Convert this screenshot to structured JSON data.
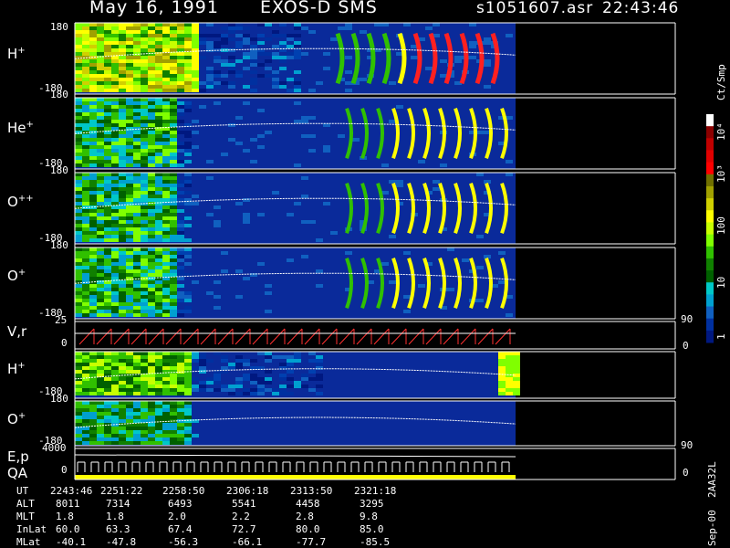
{
  "header": {
    "date": "May 16, 1991",
    "instrument": "EXOS-D SMS",
    "file": "s1051607.asr",
    "time": "22:43:46"
  },
  "panels": [
    {
      "label": "H",
      "sup": "+",
      "ymax": "180",
      "ymin": "-180"
    },
    {
      "label": "He",
      "sup": "+",
      "ymax": "180",
      "ymin": "-180"
    },
    {
      "label": "O",
      "sup": "++",
      "ymax": "180",
      "ymin": "-180"
    },
    {
      "label": "O",
      "sup": "+",
      "ymax": "180",
      "ymin": "-180"
    }
  ],
  "vr_panel": {
    "label": "V,r",
    "ymax": "25",
    "ymin": "0",
    "right_max": "90",
    "right_min": "0"
  },
  "energy_panels": [
    {
      "label": "H",
      "sup": "+",
      "ymax": "180",
      "ymin": "-180"
    },
    {
      "label": "O",
      "sup": "+",
      "ymax": "180",
      "ymin": "-180"
    }
  ],
  "ep_panel": {
    "label1": "E,p",
    "label2": "QA",
    "ymax": "4000",
    "ymin": "0",
    "right_max": "90",
    "right_min": "0"
  },
  "colorbar": {
    "unit": "Ct/Smp",
    "ticks": [
      "10⁴",
      "10³",
      "100",
      "10",
      "1"
    ],
    "colors": [
      "#ffffff",
      "#8b0000",
      "#c00000",
      "#e00000",
      "#ff0000",
      "#707000",
      "#a0a000",
      "#d0d000",
      "#ffff00",
      "#c8ff00",
      "#80ff00",
      "#30c000",
      "#108000",
      "#006000",
      "#00c8c8",
      "#00a0d0",
      "#1060c0",
      "#0030a0",
      "#001880"
    ]
  },
  "footer": {
    "rows": [
      {
        "name": "UT",
        "values": [
          "2243:46",
          "2251:22",
          "2258:50",
          "2306:18",
          "2313:50",
          "2321:18"
        ]
      },
      {
        "name": "ALT",
        "values": [
          "8011",
          "7314",
          "6493",
          "5541",
          "4458",
          "3295"
        ]
      },
      {
        "name": "MLT",
        "values": [
          "1.8",
          "1.8",
          "2.0",
          "2.2",
          "2.8",
          "9.8"
        ]
      },
      {
        "name": "InLat",
        "values": [
          "60.0",
          "63.3",
          "67.4",
          "72.7",
          "80.0",
          "85.0"
        ]
      },
      {
        "name": "MLat",
        "values": [
          "-40.1",
          "-47.8",
          "-56.3",
          "-66.1",
          "-77.7",
          "-85.5"
        ]
      }
    ],
    "version": "Sep-00  2AA32L"
  },
  "chart_data": {
    "type": "heatmap",
    "title": "May 16, 1991   EXOS-D SMS",
    "x_ticks": [
      "2243:46",
      "2251:22",
      "2258:50",
      "2306:18",
      "2313:50",
      "2321:18"
    ],
    "panels": [
      "H+",
      "He+",
      "O++",
      "O+",
      "V,r",
      "H+",
      "O+",
      "E,p QA"
    ],
    "y_range": [
      -180,
      180
    ],
    "color_scale": {
      "log": true,
      "range": [
        1,
        10000
      ],
      "unit": "Ct/Smp"
    }
  }
}
